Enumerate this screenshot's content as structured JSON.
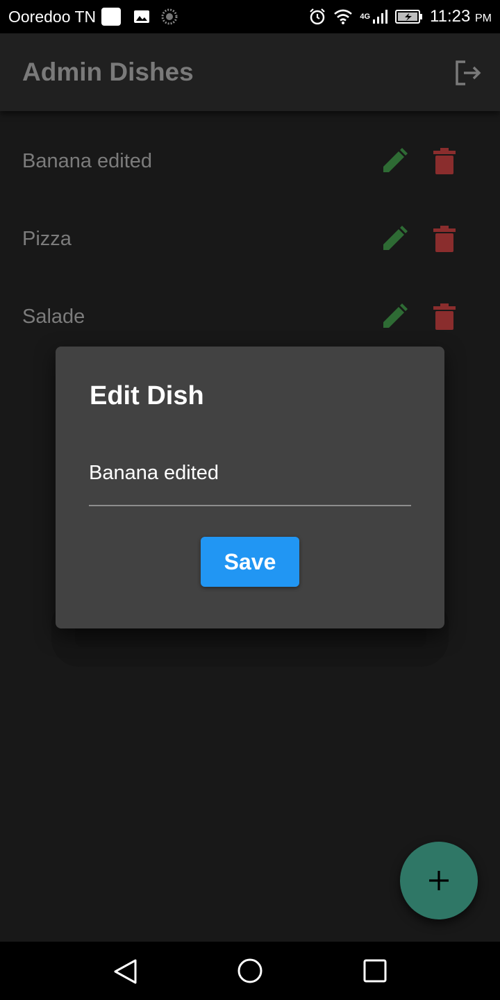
{
  "status_bar": {
    "carrier": "Ooredoo TN",
    "time": "11:23",
    "ampm": "PM",
    "network": "4G",
    "icons": [
      "app-square-icon",
      "gallery-icon",
      "spinner-icon",
      "alarm-icon",
      "wifi-icon",
      "signal-icon",
      "battery-charging-icon"
    ]
  },
  "app_bar": {
    "title": "Admin Dishes",
    "action_icon": "logout-icon"
  },
  "dishes": [
    {
      "name": "Banana edited"
    },
    {
      "name": "Pizza"
    },
    {
      "name": "Salade"
    }
  ],
  "dialog": {
    "title": "Edit Dish",
    "input_value": "Banana edited",
    "save_label": "Save"
  },
  "fab": {
    "icon": "plus-icon"
  },
  "nav_bar": {
    "icons": [
      "back-icon",
      "home-icon",
      "recent-apps-icon"
    ]
  },
  "colors": {
    "accent": "#2196f3",
    "edit": "#2e6b34",
    "delete": "#8a2d2d",
    "fab": "#2f7766",
    "dialog_bg": "#424242",
    "app_bar_bg": "#202020"
  }
}
